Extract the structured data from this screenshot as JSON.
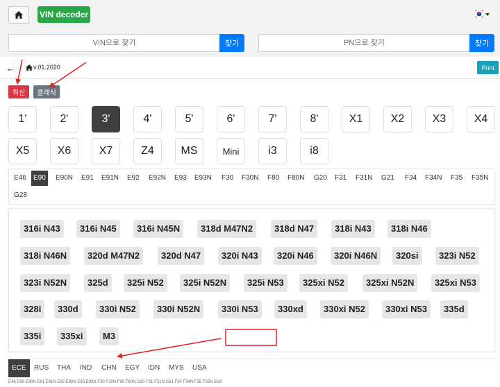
{
  "topbar": {
    "vin_decoder_label": "VIN decoder"
  },
  "search": {
    "vin_placeholder": "VIN으로 찾기",
    "pn_placeholder": "PN으로 찾기",
    "vin_button": "찾기",
    "pn_button": "찾기"
  },
  "crumb": {
    "version": "v.01.2020",
    "print_label": "Print"
  },
  "filters": {
    "latest": "최신",
    "classic": "클래식"
  },
  "series": [
    "1'",
    "2'",
    "3'",
    "4'",
    "5'",
    "6'",
    "7'",
    "8'",
    "X1",
    "X2",
    "X3",
    "X4",
    "X5",
    "X6",
    "X7",
    "Z4",
    "MS",
    "Mini",
    "i3",
    "i8"
  ],
  "chassis": [
    "E46",
    "E90",
    "E90N",
    "E91",
    "E91N",
    "E92",
    "E92N",
    "E93",
    "E93N",
    "F30",
    "F30N",
    "F80",
    "F80N",
    "G20",
    "F31",
    "F31N",
    "G21",
    "F34",
    "F34N",
    "F35",
    "F35N",
    "G28"
  ],
  "models": [
    "316i N43",
    "316i N45",
    "316i N45N",
    "318d M47N2",
    "318d N47",
    "318i N43",
    "318i N46",
    "318i N46N",
    "320d M47N2",
    "320d N47",
    "320i N43",
    "320i N46",
    "320i N46N",
    "320si",
    "323i N52",
    "323i N52N",
    "325d",
    "325i N52",
    "325i N52N",
    "325i N53",
    "325xi N52",
    "325xi N52N",
    "325xi N53",
    "328i",
    "330d",
    "330i N52",
    "330i N52N",
    "330i N53",
    "330xd",
    "330xi N52",
    "330xi N53",
    "335d",
    "335i",
    "335xi",
    "M3"
  ],
  "regions": [
    "ECE",
    "RUS",
    "THA",
    "IND",
    "CHN",
    "EGY",
    "IDN",
    "MYS",
    "USA"
  ],
  "footer": "E46 E90 E90N E91 E91N E92 E92N E93 E93N F30 F30N F80 F80N G20 F31 F31N G21 F34 F34N F35 F35N G28",
  "colors": {
    "green": "#28a745",
    "blue": "#007bff",
    "teal": "#17a2b8",
    "red": "#dc3545",
    "gray": "#6c757d",
    "dark": "#3f3f3f",
    "annotation": "#e02020"
  }
}
